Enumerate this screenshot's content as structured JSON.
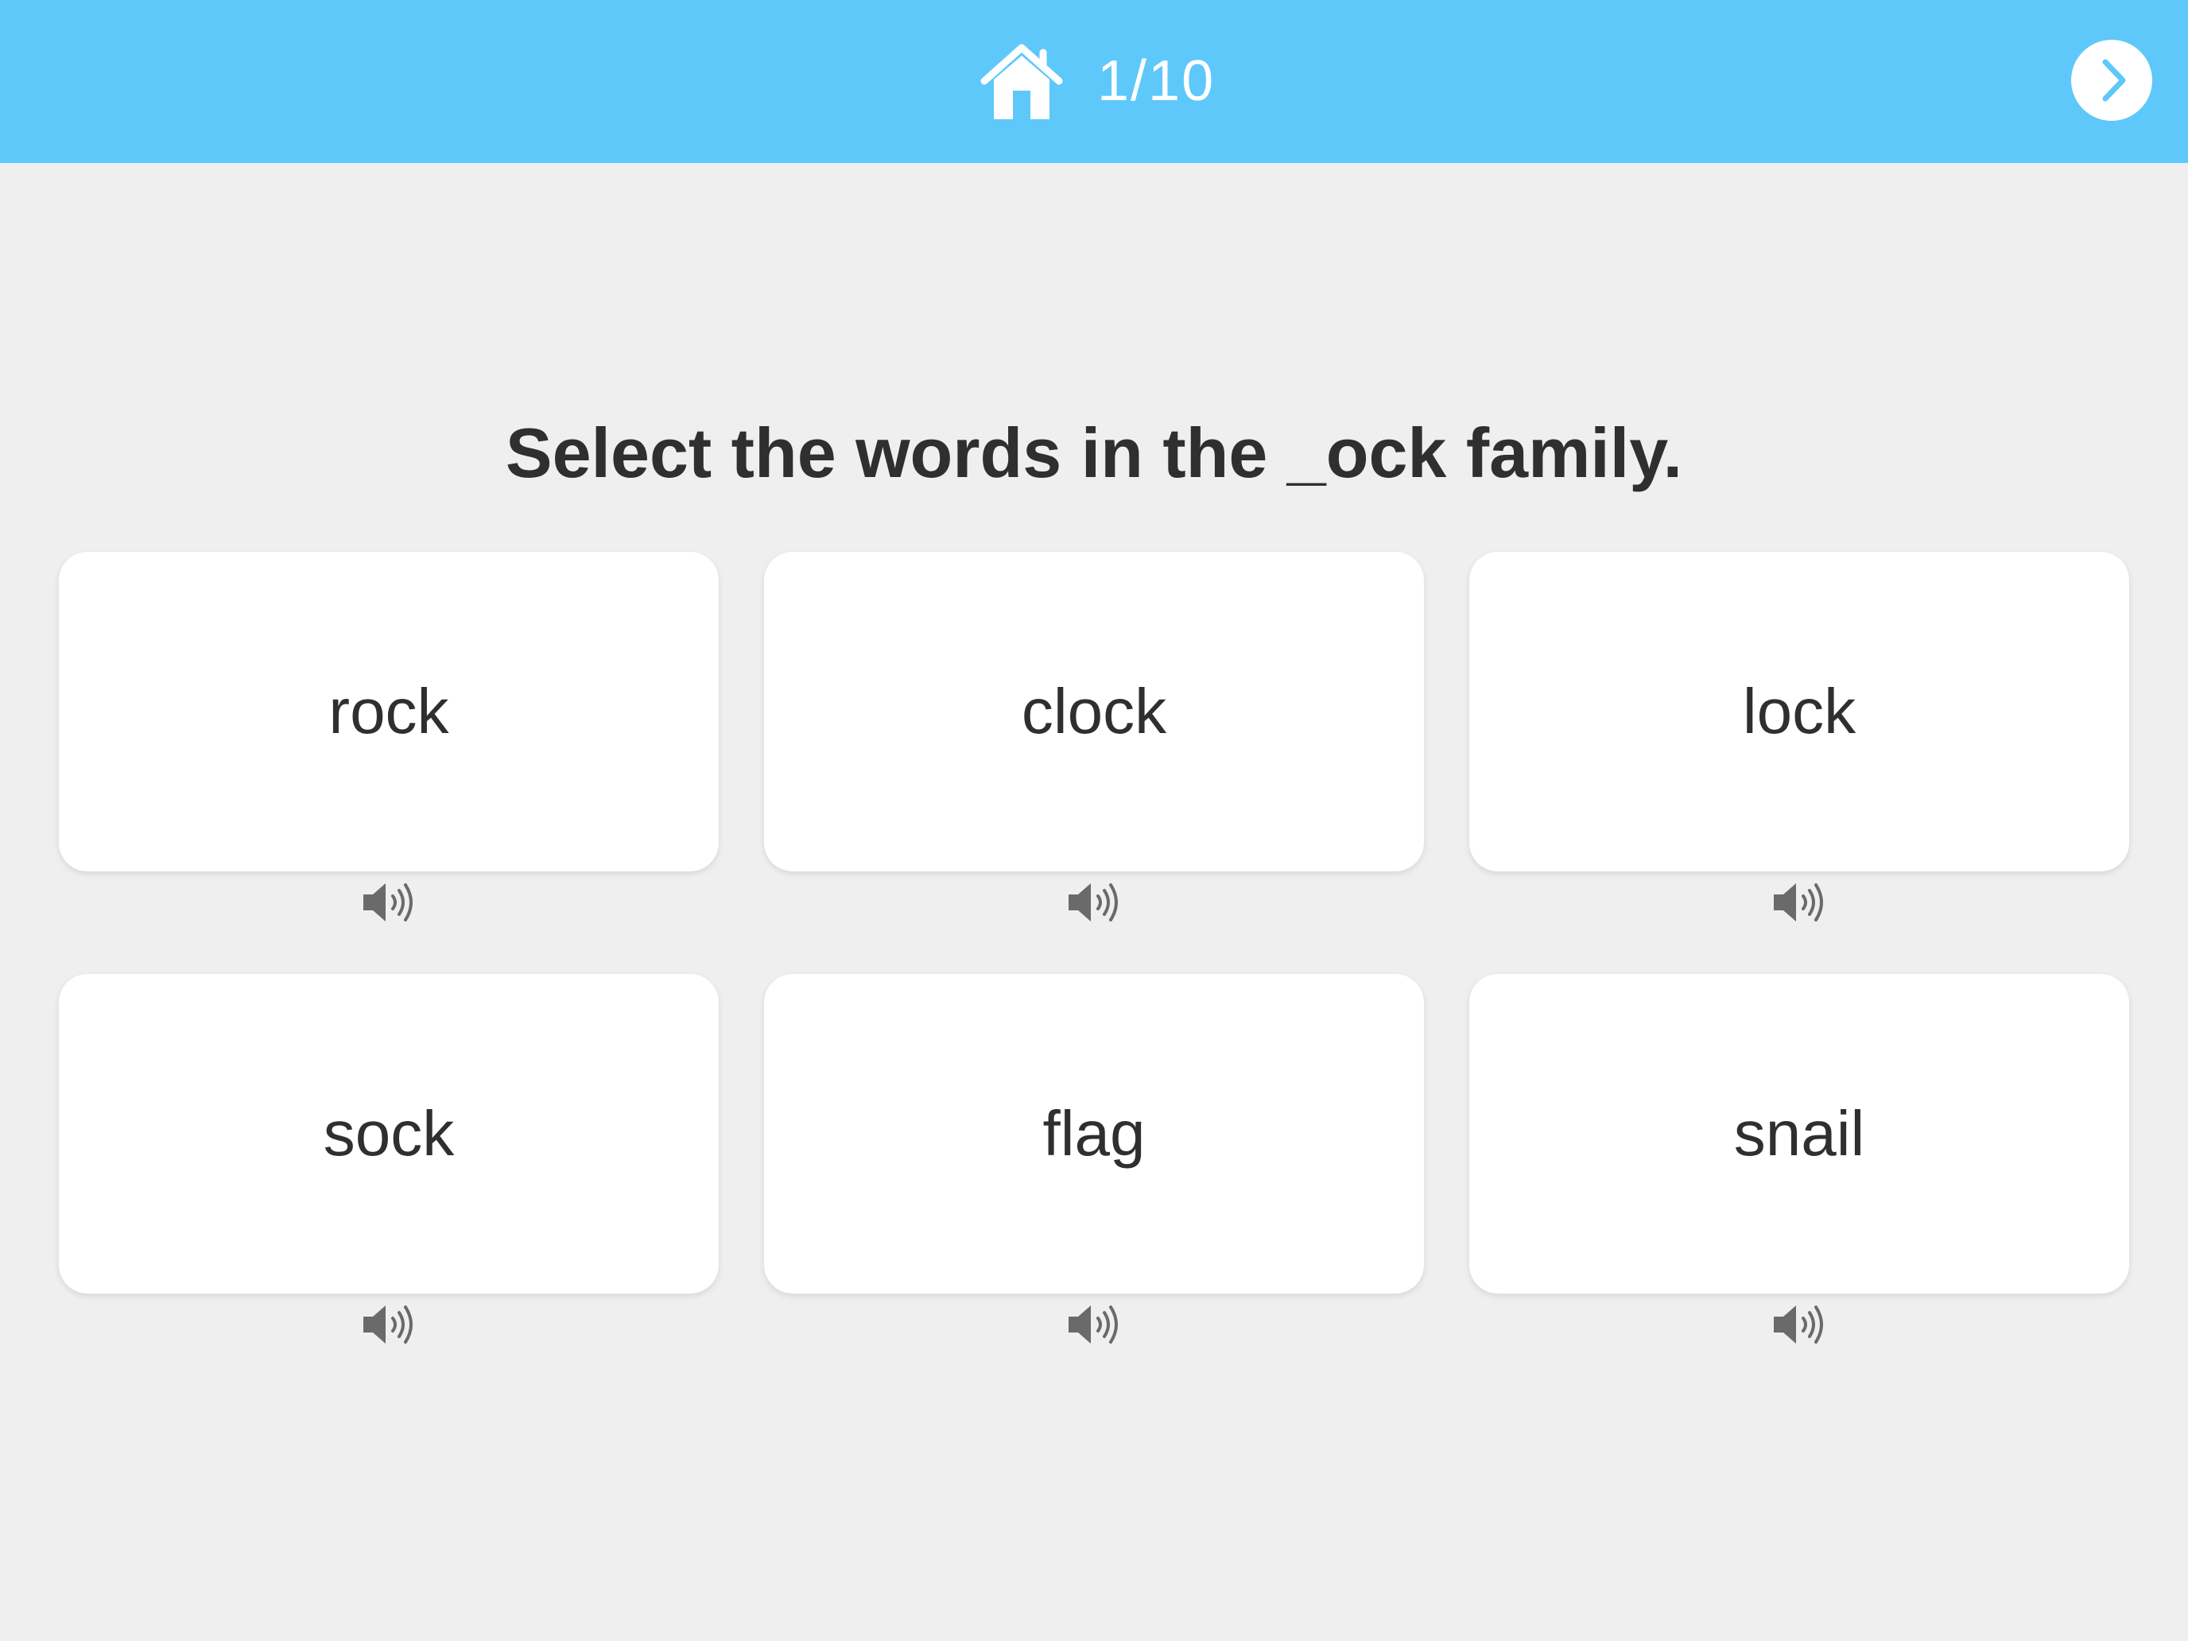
{
  "colors": {
    "topbar": "#5ec8fa",
    "background": "#efefef",
    "card": "#ffffff",
    "text": "#2f2f2f",
    "icon": "#6a6a6a"
  },
  "header": {
    "home_icon": "home-icon",
    "progress": "1/10",
    "next_icon": "chevron-right-icon"
  },
  "question": "Select the words in the _ock family.",
  "options": [
    {
      "word": "rock",
      "audio_icon": "speaker-icon"
    },
    {
      "word": "clock",
      "audio_icon": "speaker-icon"
    },
    {
      "word": "lock",
      "audio_icon": "speaker-icon"
    },
    {
      "word": "sock",
      "audio_icon": "speaker-icon"
    },
    {
      "word": "flag",
      "audio_icon": "speaker-icon"
    },
    {
      "word": "snail",
      "audio_icon": "speaker-icon"
    }
  ]
}
